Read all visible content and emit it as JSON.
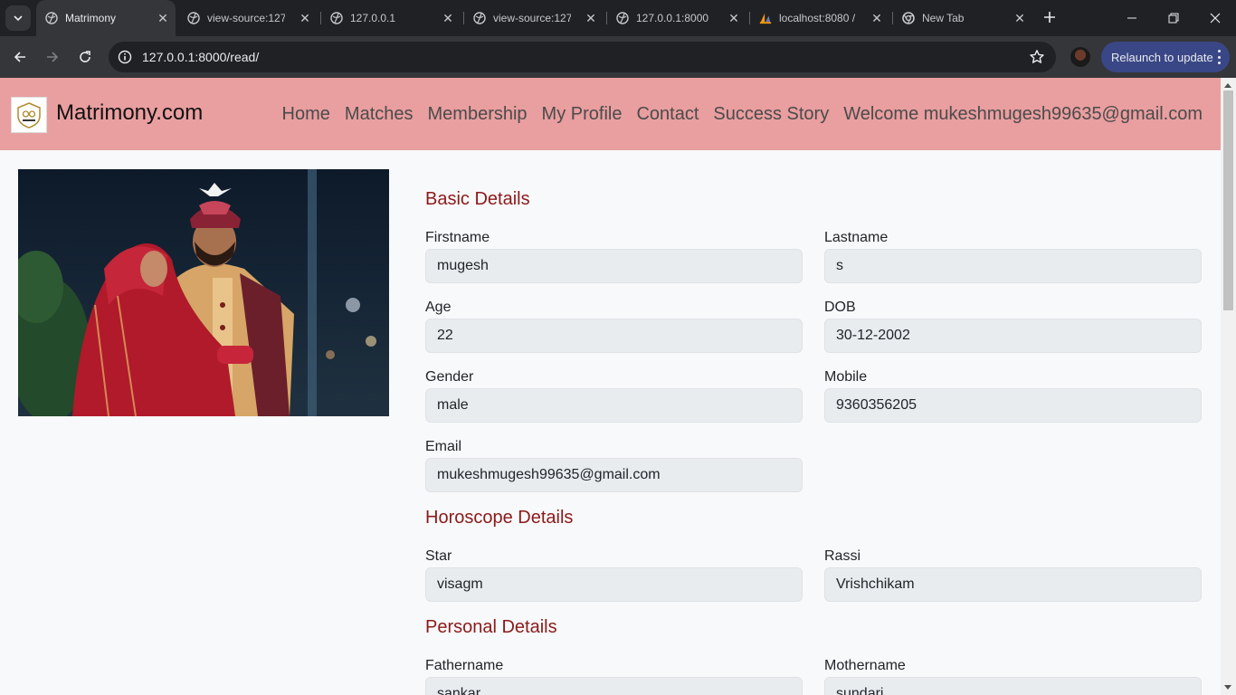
{
  "browser": {
    "tabs": [
      {
        "title": "Matrimony",
        "active": true
      },
      {
        "title": "view-source:127"
      },
      {
        "title": "127.0.0.1"
      },
      {
        "title": "view-source:127"
      },
      {
        "title": "127.0.0.1:8000"
      },
      {
        "title": "localhost:8080 /"
      },
      {
        "title": "New Tab"
      }
    ],
    "url": "127.0.0.1:8000/read/",
    "relaunch_label": "Relaunch to update",
    "accent": "#3a4786"
  },
  "site": {
    "brand": "Matrimony.com",
    "nav": [
      "Home",
      "Matches",
      "Membership",
      "My Profile",
      "Contact",
      "Success Story",
      "Welcome mukeshmugesh99635@gmail.com"
    ],
    "navbar_color": "#e99e9f"
  },
  "profile": {
    "basic_title": "Basic Details",
    "firstname_label": "Firstname",
    "firstname": "mugesh",
    "lastname_label": "Lastname",
    "lastname": "s",
    "age_label": "Age",
    "age": "22",
    "dob_label": "DOB",
    "dob": "30-12-2002",
    "gender_label": "Gender",
    "gender": "male",
    "mobile_label": "Mobile",
    "mobile": "9360356205",
    "email_label": "Email",
    "email": "mukeshmugesh99635@gmail.com",
    "horoscope_title": "Horoscope Details",
    "star_label": "Star",
    "star": "visagm",
    "rassi_label": "Rassi",
    "rassi": "Vrishchikam",
    "personal_title": "Personal Details",
    "fathername_label": "Fathername",
    "fathername": "sankar",
    "mothername_label": "Mothername",
    "mothername": "sundari"
  }
}
